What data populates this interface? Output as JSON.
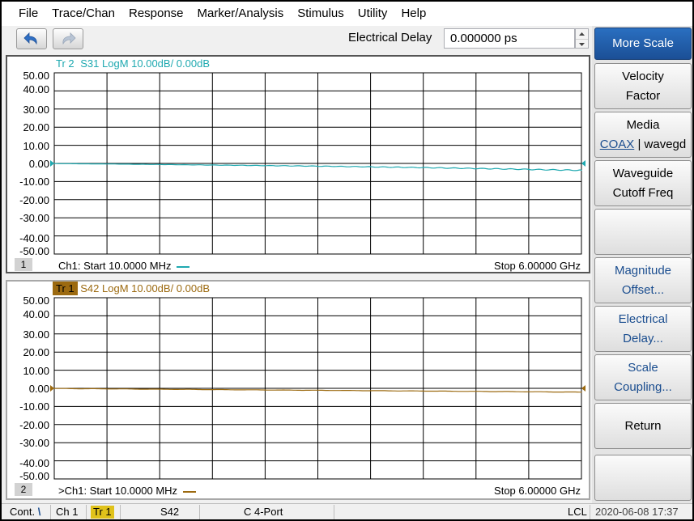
{
  "menu": [
    "File",
    "Trace/Chan",
    "Response",
    "Marker/Analysis",
    "Stimulus",
    "Utility",
    "Help"
  ],
  "toolbar": {
    "undo_icon": "undo-arrow-icon",
    "redo_icon": "redo-arrow-icon",
    "electrical_delay_label": "Electrical Delay",
    "electrical_delay_value": "0.000000 ps"
  },
  "softkeys": [
    {
      "line1": "More Scale",
      "line2": "",
      "active": true
    },
    {
      "line1": "Velocity",
      "line2": "Factor"
    },
    {
      "line1": "Media",
      "line2_link": "COAX",
      "line2_rest": " | wavegd"
    },
    {
      "line1": "Waveguide",
      "line2": "Cutoff Freq"
    },
    {
      "line1": "",
      "line2": ""
    },
    {
      "line1": "Magnitude",
      "line2": "Offset..."
    },
    {
      "line1": "Electrical",
      "line2": "Delay..."
    },
    {
      "line1": "Scale",
      "line2": "Coupling..."
    },
    {
      "line1": "Return",
      "line2": ""
    },
    {
      "line1": "",
      "line2": ""
    }
  ],
  "channels": [
    {
      "trace_prefix": "Tr 2",
      "trace_desc": "S31 LogM 10.00dB/ 0.00dB",
      "trace_color": "#1fa9b0",
      "channel_number": "1",
      "start_label": "Ch1: Start  10.0000 MHz",
      "stop_label": "Stop  6.00000 GHz",
      "y_labels": [
        "50.00",
        "40.00",
        "30.00",
        "20.00",
        "10.00",
        "0.00",
        "-10.00",
        "-20.00",
        "-30.00",
        "-40.00",
        "-50.00"
      ],
      "active": true
    },
    {
      "trace_prefix": "Tr 1",
      "trace_desc": "S42 LogM 10.00dB/ 0.00dB",
      "trace_color": "#9c6a10",
      "channel_number": "2",
      "start_label": ">Ch1: Start  10.0000 MHz",
      "stop_label": "Stop  6.00000 GHz",
      "y_labels": [
        "50.00",
        "40.00",
        "30.00",
        "20.00",
        "10.00",
        "0.00",
        "-10.00",
        "-20.00",
        "-30.00",
        "-40.00",
        "-50.00"
      ],
      "active": false
    }
  ],
  "chart_data": [
    {
      "type": "line",
      "title": "Tr 2  S31 LogM 10.00dB/ 0.00dB",
      "xlabel": "",
      "ylabel": "",
      "x_start": "10.0000 MHz",
      "x_stop": "6.00000 GHz",
      "x": [
        0.01,
        0.6,
        1.2,
        1.8,
        2.4,
        3.0,
        3.6,
        4.2,
        4.8,
        5.4,
        6.0
      ],
      "ylim": [
        -50,
        50
      ],
      "grid": true,
      "series": [
        {
          "name": "S31",
          "values": [
            -0.1,
            -0.3,
            -0.6,
            -0.9,
            -1.2,
            -1.5,
            -1.9,
            -2.3,
            -2.8,
            -3.3,
            -3.8
          ]
        }
      ]
    },
    {
      "type": "line",
      "title": "Tr 1  S42 LogM 10.00dB/ 0.00dB",
      "xlabel": "",
      "ylabel": "",
      "x_start": "10.0000 MHz",
      "x_stop": "6.00000 GHz",
      "x": [
        0.01,
        0.6,
        1.2,
        1.8,
        2.4,
        3.0,
        3.6,
        4.2,
        4.8,
        5.4,
        6.0
      ],
      "ylim": [
        -50,
        50
      ],
      "grid": true,
      "series": [
        {
          "name": "S42",
          "values": [
            -0.1,
            -0.3,
            -0.5,
            -0.7,
            -0.9,
            -1.1,
            -1.3,
            -1.5,
            -1.7,
            -1.9,
            -2.1
          ]
        }
      ]
    }
  ],
  "status": {
    "cont": "Cont.",
    "ch": "Ch 1",
    "tr": "Tr 1",
    "param": "S42",
    "cal": "C  4-Port",
    "lcl": "LCL",
    "datetime": "2020-06-08 17:37"
  }
}
